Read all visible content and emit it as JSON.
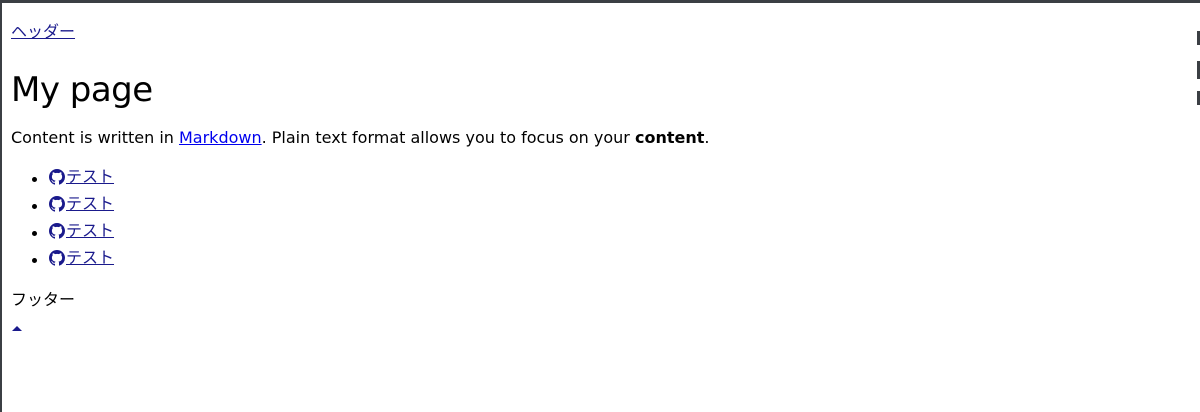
{
  "header": {
    "link_label": "ヘッダー"
  },
  "main": {
    "title": "My page",
    "paragraph": {
      "prefix": "Content is written in ",
      "link_label": "Markdown",
      "middle": ". Plain text format allows you to focus on your ",
      "bold": "content",
      "suffix": "."
    },
    "links": [
      {
        "icon": "github-icon",
        "label": "テスト"
      },
      {
        "icon": "github-icon",
        "label": "テスト"
      },
      {
        "icon": "github-icon",
        "label": "テスト"
      },
      {
        "icon": "github-icon",
        "label": "テスト"
      }
    ]
  },
  "footer": {
    "text": "フッター",
    "top_icon": "caret-up-icon"
  },
  "colors": {
    "link": "#1a1a8c",
    "frame": "#3b3f44",
    "background": "#ffffff"
  }
}
